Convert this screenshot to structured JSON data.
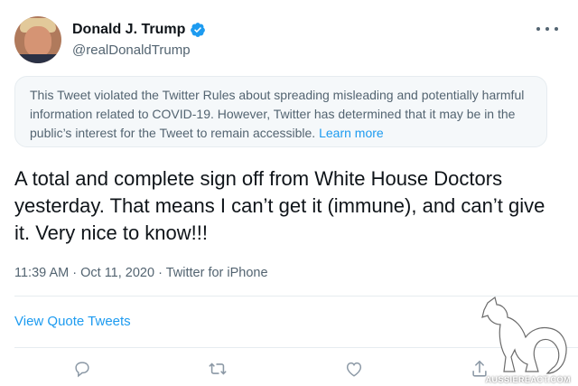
{
  "author": {
    "display_name": "Donald J. Trump",
    "handle": "@realDonaldTrump",
    "verified": true,
    "avatar_icon": "profile-photo"
  },
  "notice": {
    "text": "This Tweet violated the Twitter Rules about spreading misleading and potentially harmful information related to COVID-19. However, Twitter has determined that it may be in the public’s interest for the Tweet to remain accessible.",
    "link_label": "Learn more"
  },
  "tweet": {
    "text": "A total and complete sign off from White House Doctors yesterday. That means I can’t get it (immune), and can’t give it. Very nice to know!!!"
  },
  "meta": {
    "time": "11:39 AM",
    "date": "Oct 11, 2020",
    "source": "Twitter for iPhone",
    "separator": "·"
  },
  "quote_link": "View Quote Tweets",
  "actions": [
    "reply-icon",
    "retweet-icon",
    "like-icon",
    "share-icon"
  ],
  "colors": {
    "accent": "#1d9bf0",
    "text_primary": "#0f1419",
    "text_secondary": "#536471",
    "notice_bg": "#f5f8fa",
    "border": "#e6ecf0"
  },
  "watermark": {
    "icon": "kangaroo-logo",
    "text": "AUSSIEREACT.COM"
  }
}
